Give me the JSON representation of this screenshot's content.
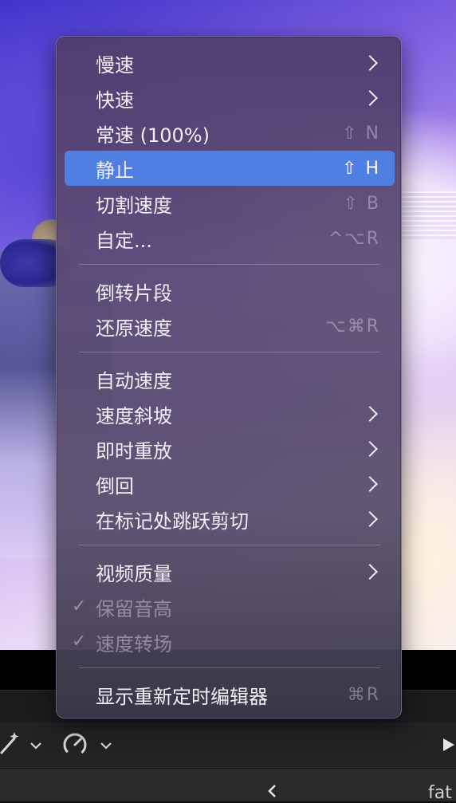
{
  "menu": {
    "items": [
      {
        "label": "慢速",
        "shortcut": "",
        "submenu": true
      },
      {
        "label": "快速",
        "shortcut": "",
        "submenu": true
      },
      {
        "label": "常速 (100%)",
        "shortcut": "⇧ N",
        "submenu": false
      },
      {
        "label": "静止",
        "shortcut": "⇧ H",
        "submenu": false,
        "highlighted": true
      },
      {
        "label": "切割速度",
        "shortcut": "⇧ B",
        "submenu": false
      },
      {
        "label": "自定...",
        "shortcut": "^⌥R",
        "submenu": false
      },
      {
        "label": "倒转片段",
        "shortcut": "",
        "submenu": false
      },
      {
        "label": "还原速度",
        "shortcut": "⌥⌘R",
        "submenu": false
      },
      {
        "label": "自动速度",
        "shortcut": "",
        "submenu": false
      },
      {
        "label": "速度斜坡",
        "shortcut": "",
        "submenu": true
      },
      {
        "label": "即时重放",
        "shortcut": "",
        "submenu": true
      },
      {
        "label": "倒回",
        "shortcut": "",
        "submenu": true
      },
      {
        "label": "在标记处跳跃剪切",
        "shortcut": "",
        "submenu": true
      },
      {
        "label": "视频质量",
        "shortcut": "",
        "submenu": true
      },
      {
        "label": "保留音高",
        "shortcut": "",
        "checked": true,
        "disabled": true
      },
      {
        "label": "速度转场",
        "shortcut": "",
        "checked": true,
        "disabled": true
      },
      {
        "label": "显示重新定时编辑器",
        "shortcut": "⌘R",
        "submenu": false
      }
    ],
    "check_glyph": "✓"
  },
  "toolbar": {
    "clip_name_partial": "fat",
    "icons": [
      "magic-wand-icon",
      "chevron-down-icon",
      "retime-gauge-icon",
      "play-icon",
      "chevron-left-icon"
    ]
  }
}
